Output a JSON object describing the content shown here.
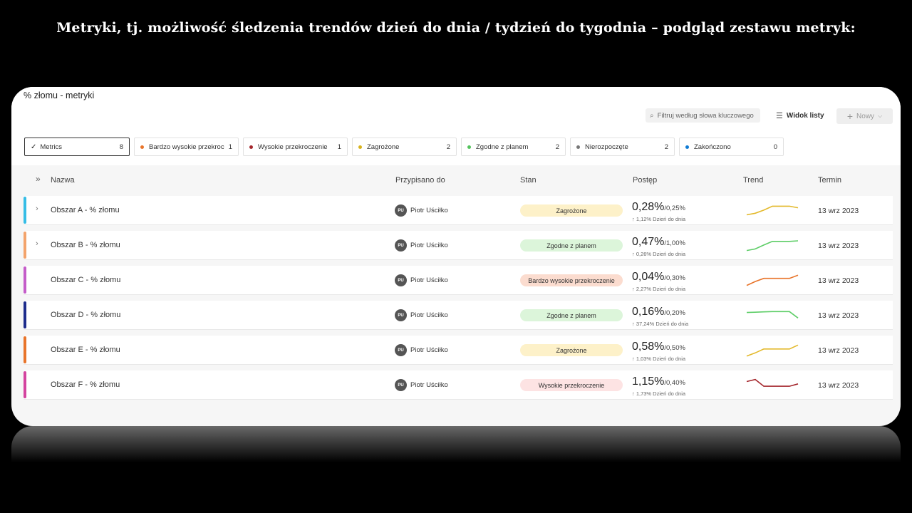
{
  "slide_heading": "Metryki, tj. możliwość śledzenia trendów dzień do dnia / tydzień do tygodnia – podgląd zestawu metryk:",
  "panel": {
    "title": "% złomu - metryki",
    "search_placeholder": "Filtruj według słowa kluczowego",
    "view_label": "Widok listy",
    "new_label": "Nowy"
  },
  "filters": [
    {
      "label": "Metrics",
      "count": "8",
      "color": "",
      "selected": true
    },
    {
      "label": "Bardzo wysokie przekroczenie",
      "count": "1",
      "color": "#e8742a",
      "selected": false
    },
    {
      "label": "Wysokie przekroczenie",
      "count": "1",
      "color": "#a4262c",
      "selected": false
    },
    {
      "label": "Zagrożone",
      "count": "2",
      "color": "#d8b31c",
      "selected": false
    },
    {
      "label": "Zgodne z planem",
      "count": "2",
      "color": "#54c35c",
      "selected": false
    },
    {
      "label": "Nierozpoczęte",
      "count": "2",
      "color": "#777777",
      "selected": false
    },
    {
      "label": "Zakończono",
      "count": "0",
      "color": "#0f7bd4",
      "selected": false
    }
  ],
  "columns": {
    "name": "Nazwa",
    "assigned": "Przypisano do",
    "status": "Stan",
    "progress": "Postęp",
    "trend": "Trend",
    "due": "Termin"
  },
  "rows": [
    {
      "name": "Obszar A - % złomu",
      "has_children": true,
      "bar_color": "#35bde6",
      "initials": "PU",
      "assignee": "Piotr Uściłko",
      "status": "Zagrożone",
      "status_bg": "#fdf1c9",
      "value": "0,28%",
      "target": "/0,25%",
      "sub": "↑ 1,12% Dzień do dnia",
      "due": "13 wrz 2023",
      "trend_color": "#e3b92b",
      "trend": [
        0.25,
        0.35,
        0.55,
        0.8,
        0.8,
        0.8,
        0.7
      ]
    },
    {
      "name": "Obszar B - % złomu",
      "has_children": true,
      "bar_color": "#f3a36b",
      "initials": "PU",
      "assignee": "Piotr Uściłko",
      "status": "Zgodne z planem",
      "status_bg": "#dcf5da",
      "value": "0,47%",
      "target": "/1,00%",
      "sub": "↑ 0,26% Dzień do dnia",
      "due": "13 wrz 2023",
      "trend_color": "#5ccd66",
      "trend": [
        0.2,
        0.3,
        0.55,
        0.78,
        0.78,
        0.78,
        0.82
      ]
    },
    {
      "name": "Obszar C - % złomu",
      "has_children": false,
      "bar_color": "#c45cc9",
      "initials": "PU",
      "assignee": "Piotr Uściłko",
      "status": "Bardzo wysokie przekroczenie",
      "status_bg": "#fbdccf",
      "value": "0,04%",
      "target": "/0,30%",
      "sub": "↑ 2,27% Dzień do dnia",
      "due": "13 wrz 2023",
      "trend_color": "#e8742a",
      "trend": [
        0.2,
        0.45,
        0.65,
        0.65,
        0.65,
        0.65,
        0.85
      ]
    },
    {
      "name": "Obszar D - % złomu",
      "has_children": false,
      "bar_color": "#1d2c8c",
      "initials": "PU",
      "assignee": "Piotr Uściłko",
      "status": "Zgodne z planem",
      "status_bg": "#dcf5da",
      "value": "0,16%",
      "target": "/0,20%",
      "sub": "↑ 37,24% Dzień do dnia",
      "due": "13 wrz 2023",
      "trend_color": "#5ccd66",
      "trend": [
        0.7,
        0.72,
        0.74,
        0.76,
        0.76,
        0.76,
        0.35
      ]
    },
    {
      "name": "Obszar E - % złomu",
      "has_children": false,
      "bar_color": "#e8742a",
      "initials": "PU",
      "assignee": "Piotr Uściłko",
      "status": "Zagrożone",
      "status_bg": "#fdf1c9",
      "value": "0,58%",
      "target": "/0,50%",
      "sub": "↑ 1,03% Dzień do dnia",
      "due": "13 wrz 2023",
      "trend_color": "#e3b92b",
      "trend": [
        0.15,
        0.35,
        0.6,
        0.6,
        0.6,
        0.6,
        0.85
      ]
    },
    {
      "name": "Obszar F - % złomu",
      "has_children": false,
      "bar_color": "#d4439f",
      "initials": "PU",
      "assignee": "Piotr Uściłko",
      "status": "Wysokie przekroczenie",
      "status_bg": "#fde3e3",
      "value": "1,15%",
      "target": "/0,40%",
      "sub": "↑ 1,73% Dzień do dnia",
      "due": "13 wrz 2023",
      "trend_color": "#a4262c",
      "trend": [
        0.75,
        0.88,
        0.45,
        0.45,
        0.45,
        0.45,
        0.6
      ]
    }
  ]
}
